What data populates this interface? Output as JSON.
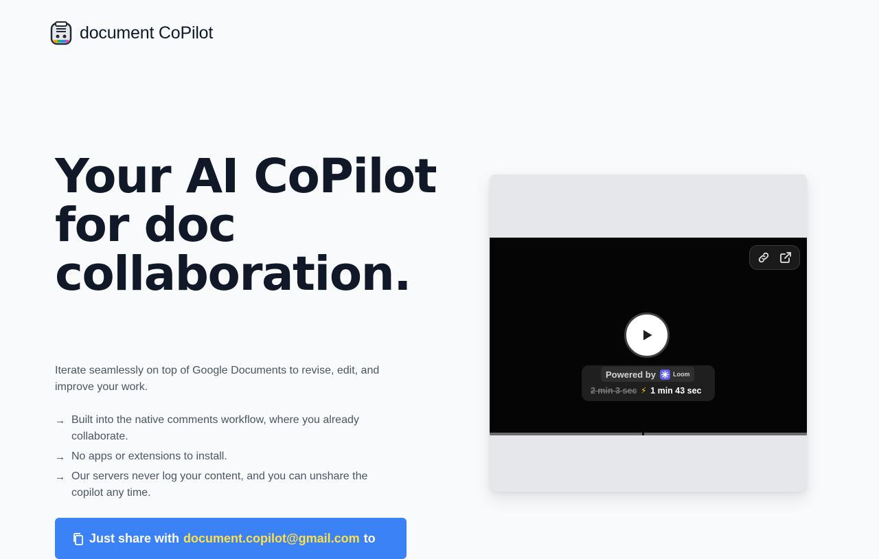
{
  "brand": {
    "name": "document CoPilot",
    "logo_icon": "robot-document-icon"
  },
  "hero": {
    "title": "Your AI CoPilot for doc collaboration.",
    "subtitle": "Iterate seamlessly on top of Google Documents to revise, edit, and improve your work."
  },
  "features": [
    "Built into the native comments workflow, where you already collaborate.",
    "No apps or extensions to install.",
    "Our servers never log your content, and you can unshare the copilot any time."
  ],
  "feature_arrow": "→",
  "cta": {
    "icon": "copy-icon",
    "prefix": "Just share with",
    "email": "document.copilot@gmail.com",
    "suffix": "to"
  },
  "video": {
    "powered_by": "Powered by",
    "provider": "Loom",
    "original_duration": "2 min 3 sec",
    "bolt": "⚡",
    "fast_duration": "1 min 43 sec",
    "progress_percent": 48,
    "icons": {
      "link": "link-icon",
      "external": "external-link-icon",
      "play": "play-icon"
    }
  },
  "colors": {
    "background": "#f8fafc",
    "heading": "#111827",
    "body_text": "#4b5563",
    "cta_background": "#3b82f6",
    "cta_email": "#fde047",
    "video_background": "#050505"
  }
}
